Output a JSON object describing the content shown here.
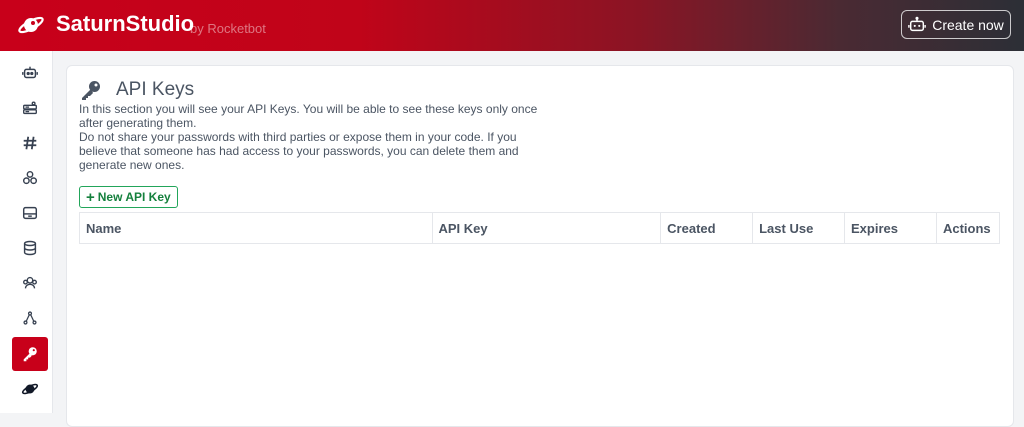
{
  "header": {
    "brand": "SaturnStudio",
    "brand_sub": "by Rocketbot",
    "create_button": "Create now",
    "colors": {
      "brand_red": "#c8001a",
      "dark": "#2c2f36"
    }
  },
  "sidebar": {
    "items": [
      {
        "icon": "robot-icon",
        "active": false
      },
      {
        "icon": "server-icon",
        "active": false
      },
      {
        "icon": "hashtag-icon",
        "active": false
      },
      {
        "icon": "cluster-icon",
        "active": false
      },
      {
        "icon": "inbox-icon",
        "active": false
      },
      {
        "icon": "database-icon",
        "active": false
      },
      {
        "icon": "users-icon",
        "active": false
      },
      {
        "icon": "network-icon",
        "active": false
      },
      {
        "icon": "key-icon",
        "active": true
      },
      {
        "icon": "saturn-icon",
        "active": false
      }
    ]
  },
  "main": {
    "title": "API Keys",
    "description": [
      "In this section you will see your API Keys. You will be able to see these keys only once after generating them.",
      "Do not share your passwords with third parties or expose them in your code. If you believe that someone has had access to your passwords, you can delete them and generate new ones."
    ],
    "new_key_button": "New API Key",
    "table": {
      "columns": [
        "Name",
        "API Key",
        "Created",
        "Last Use",
        "Expires",
        "Actions"
      ],
      "rows": []
    }
  }
}
